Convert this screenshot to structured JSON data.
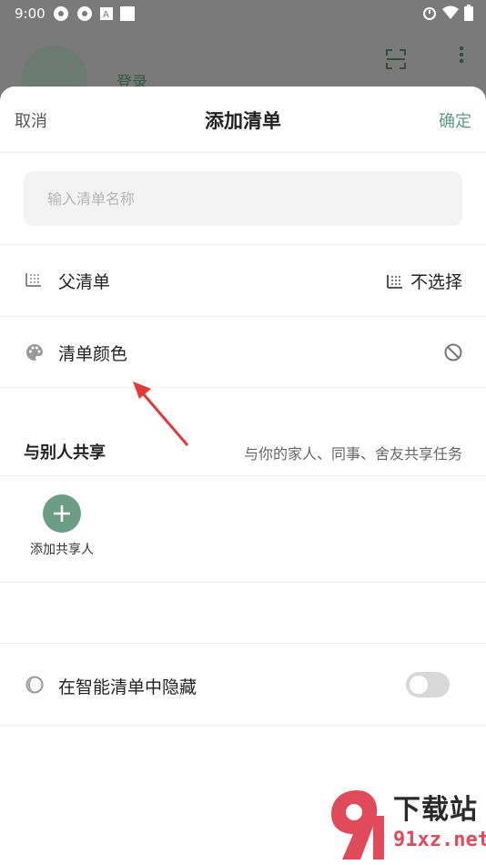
{
  "status_bar": {
    "time": "9:00"
  },
  "background": {
    "login_label": "登录"
  },
  "sheet": {
    "cancel_label": "取消",
    "title": "添加清单",
    "confirm_label": "确定",
    "name_input": {
      "placeholder": "输入清单名称",
      "value": ""
    },
    "parent_list": {
      "label": "父清单",
      "value": "不选择"
    },
    "list_color": {
      "label": "清单颜色"
    },
    "share": {
      "title": "与别人共享",
      "hint": "与你的家人、同事、舍友共享任务",
      "add_label": "添加共享人"
    },
    "hide_in_smart_list": {
      "label": "在智能清单中隐藏",
      "enabled": false
    }
  },
  "watermark": {
    "text": "下载站",
    "url": "91xz.net"
  },
  "colors": {
    "accent": "#5b9a7c",
    "add_button": "#6a9d83",
    "arrow": "#e23a3a"
  }
}
